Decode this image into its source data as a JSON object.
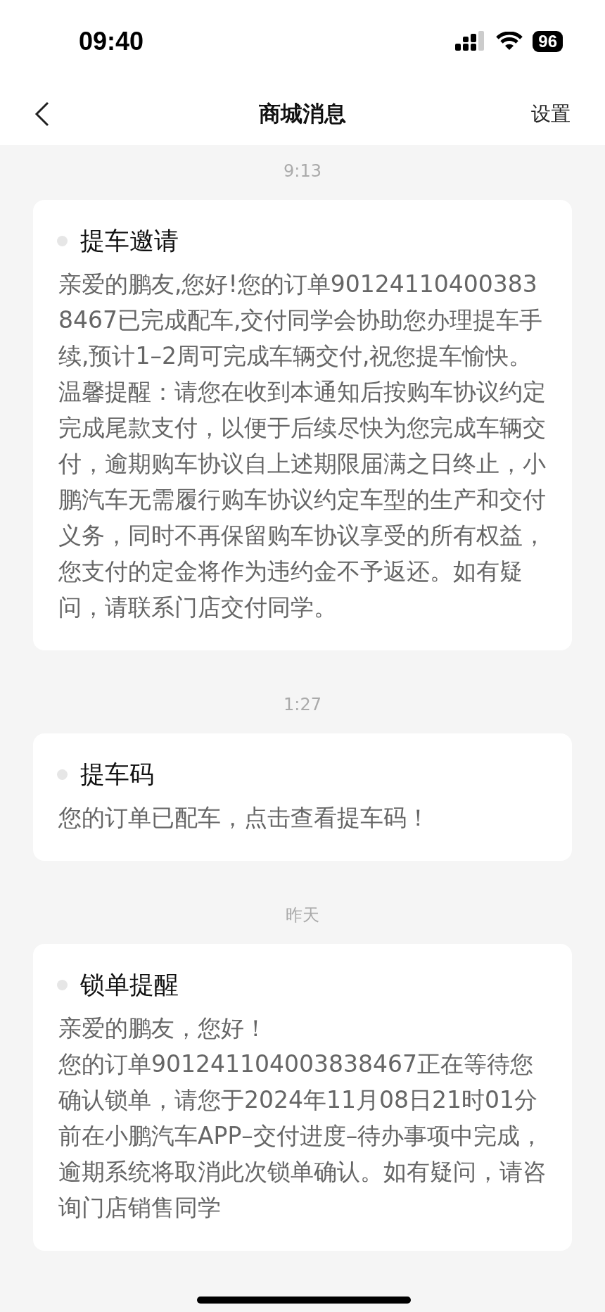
{
  "status_bar": {
    "time": "09:40",
    "battery": "96"
  },
  "nav": {
    "title": "商城消息",
    "action": "设置"
  },
  "messages": [
    {
      "time": "9:13",
      "title": "提车邀请",
      "paragraphs": [
        "亲爱的鹏友,您好!您的订单901241104003838467已完成配车,交付同学会协助您办理提车手续,预计1–2周可完成车辆交付,祝您提车愉快。",
        "温馨提醒：请您在收到本通知后按购车协议约定完成尾款支付，以便于后续尽快为您完成车辆交付，逾期购车协议自上述期限届满之日终止，小鹏汽车无需履行购车协议约定车型的生产和交付义务，同时不再保留购车协议享受的所有权益，您支付的定金将作为违约金不予返还。如有疑问，请联系门店交付同学。"
      ]
    },
    {
      "time": "1:27",
      "title": "提车码",
      "paragraphs": [
        "您的订单已配车，点击查看提车码！"
      ]
    },
    {
      "time": "昨天",
      "title": "锁单提醒",
      "paragraphs": [
        "亲爱的鹏友，您好！",
        "您的订单901241104003838467正在等待您确认锁单，请您于2024年11月08日21时01分前在小鹏汽车APP–交付进度–待办事项中完成，逾期系统将取消此次锁单确认。如有疑问，请咨询门店销售同学"
      ]
    }
  ]
}
